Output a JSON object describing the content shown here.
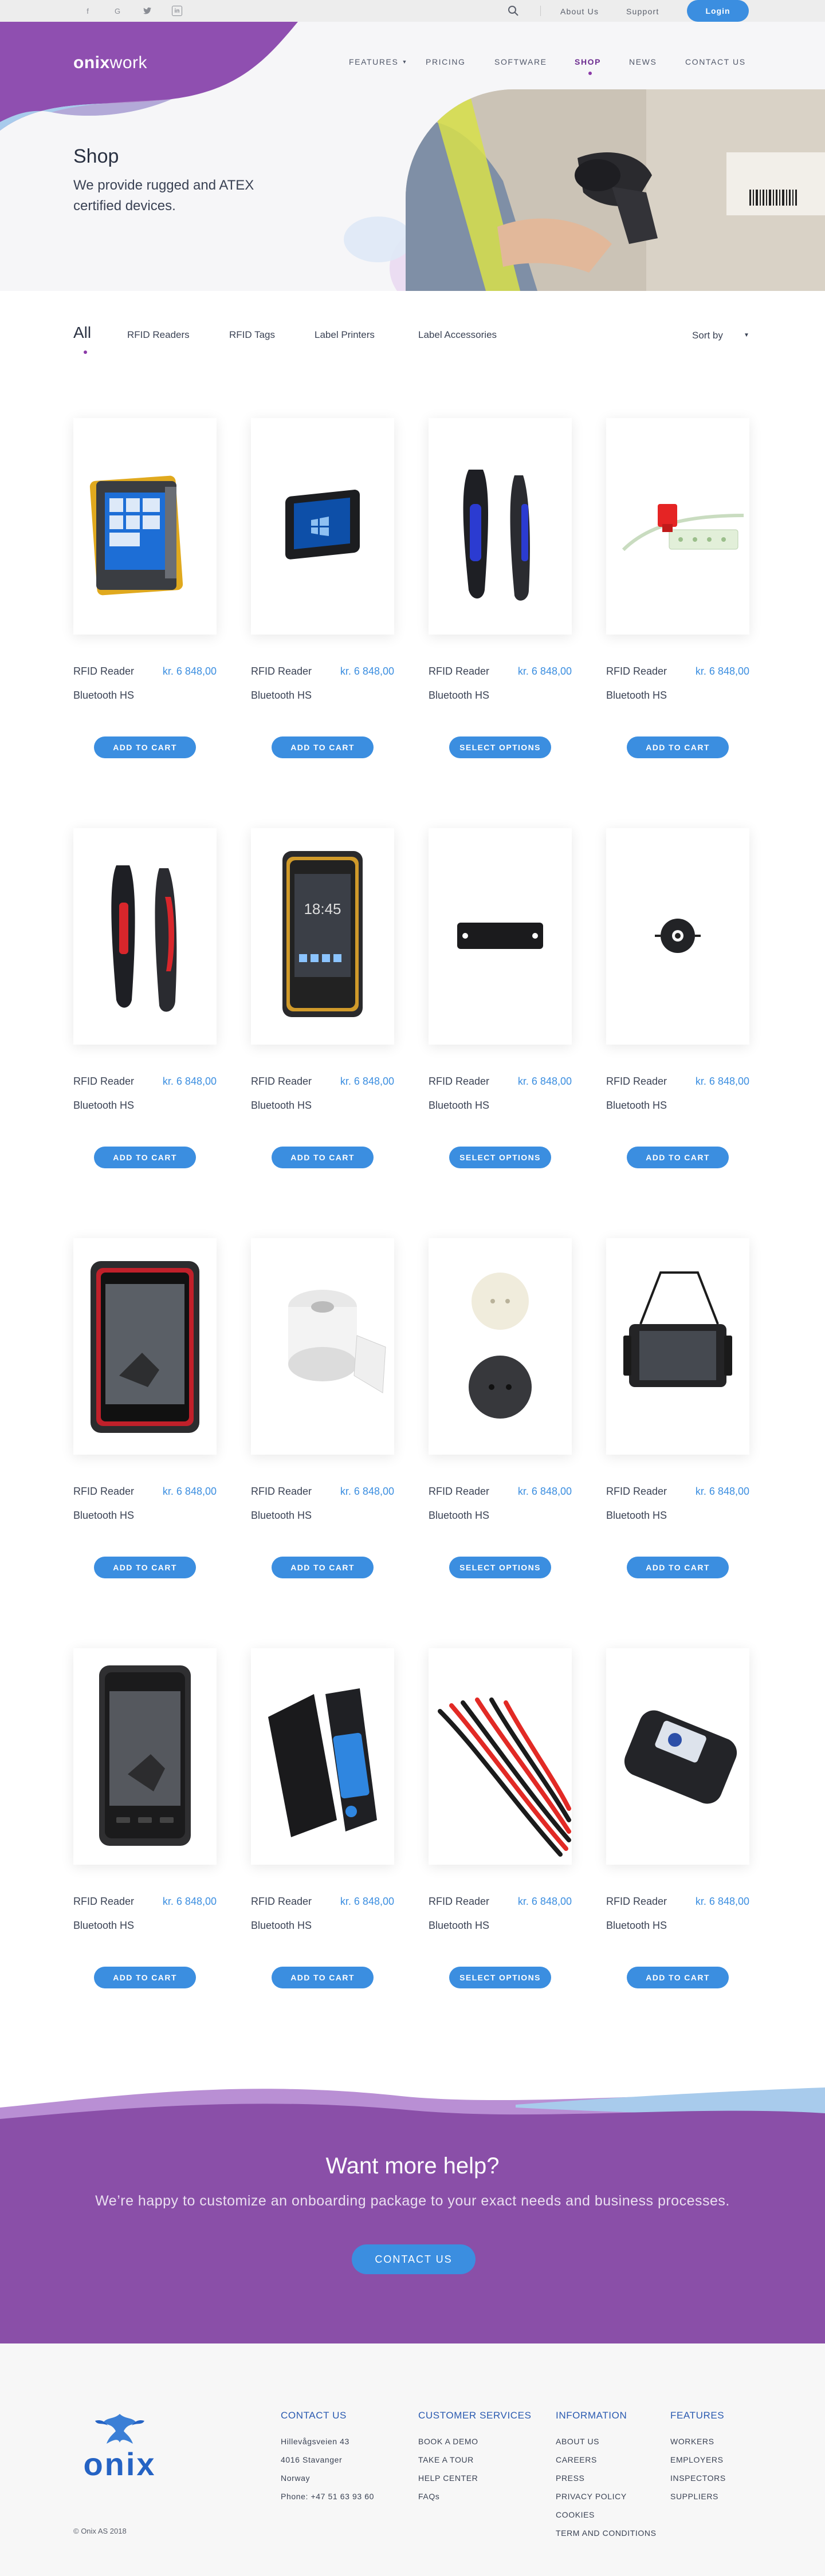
{
  "topbar": {
    "social": [
      {
        "icon": "facebook-icon",
        "glyph": "f"
      },
      {
        "icon": "google-icon",
        "glyph": "G"
      },
      {
        "icon": "twitter-icon",
        "glyph": "🐦"
      },
      {
        "icon": "linkedin-icon",
        "glyph": "in"
      }
    ],
    "about": "About Us",
    "support": "Support",
    "login": "Login"
  },
  "header": {
    "logo_main": "onix",
    "logo_suffix": "work",
    "nav": [
      "FEATURES",
      "PRICING",
      "SOFTWARE",
      "SHOP",
      "NEWS",
      "CONTACT US"
    ],
    "active": "SHOP"
  },
  "hero": {
    "title": "Shop",
    "subtitle": "We provide rugged and ATEX certified devices."
  },
  "filters": {
    "items": [
      "All",
      "RFID Readers",
      "RFID Tags",
      "Label Printers",
      "Label Accessories"
    ],
    "sort_label": "Sort by"
  },
  "products": [
    {
      "name": "RFID Reader",
      "price": "kr. 6 848,00",
      "sub": "Bluetooth HS",
      "button": "ADD TO CART",
      "image": "rugged-tablet-yellow"
    },
    {
      "name": "RFID Reader",
      "price": "kr. 6 848,00",
      "sub": "Bluetooth HS",
      "button": "ADD TO CART",
      "image": "black-tablet-windows"
    },
    {
      "name": "RFID Reader",
      "price": "kr. 6 848,00",
      "sub": "Bluetooth HS",
      "button": "SELECT OPTIONS",
      "image": "handheld-blue"
    },
    {
      "name": "RFID Reader",
      "price": "kr. 6 848,00",
      "sub": "Bluetooth HS",
      "button": "ADD TO CART",
      "image": "cable-tie-tag"
    },
    {
      "name": "RFID Reader",
      "price": "kr. 6 848,00",
      "sub": "Bluetooth HS",
      "button": "ADD TO CART",
      "image": "handheld-red"
    },
    {
      "name": "RFID Reader",
      "price": "kr. 6 848,00",
      "sub": "Bluetooth HS",
      "button": "ADD TO CART",
      "image": "rugged-phone"
    },
    {
      "name": "RFID Reader",
      "price": "kr. 6 848,00",
      "sub": "Bluetooth HS",
      "button": "SELECT OPTIONS",
      "image": "metal-tag"
    },
    {
      "name": "RFID Reader",
      "price": "kr. 6 848,00",
      "sub": "Bluetooth HS",
      "button": "ADD TO CART",
      "image": "round-tag-black"
    },
    {
      "name": "RFID Reader",
      "price": "kr. 6 848,00",
      "sub": "Bluetooth HS",
      "button": "ADD TO CART",
      "image": "rugged-tablet-red"
    },
    {
      "name": "RFID Reader",
      "price": "kr. 6 848,00",
      "sub": "Bluetooth HS",
      "button": "ADD TO CART",
      "image": "label-roll"
    },
    {
      "name": "RFID Reader",
      "price": "kr. 6 848,00",
      "sub": "Bluetooth HS",
      "button": "SELECT OPTIONS",
      "image": "round-tags"
    },
    {
      "name": "RFID Reader",
      "price": "kr. 6 848,00",
      "sub": "Bluetooth HS",
      "button": "ADD TO CART",
      "image": "tablet-strap"
    },
    {
      "name": "RFID Reader",
      "price": "kr. 6 848,00",
      "sub": "Bluetooth HS",
      "button": "ADD TO CART",
      "image": "rugged-phone-dark"
    },
    {
      "name": "RFID Reader",
      "price": "kr. 6 848,00",
      "sub": "Bluetooth HS",
      "button": "ADD TO CART",
      "image": "blue-reader"
    },
    {
      "name": "RFID Reader",
      "price": "kr. 6 848,00",
      "sub": "Bluetooth HS",
      "button": "SELECT OPTIONS",
      "image": "cable-ties"
    },
    {
      "name": "RFID Reader",
      "price": "kr. 6 848,00",
      "sub": "Bluetooth HS",
      "button": "ADD TO CART",
      "image": "card-reader"
    }
  ],
  "cta": {
    "title": "Want more help?",
    "subtitle": "We’re happy to customize an onboarding package to your exact needs and business processes.",
    "button": "CONTACT US"
  },
  "footer": {
    "logo_text": "onix",
    "copyright": "© Onix AS 2018",
    "columns": [
      {
        "title": "CONTACT US",
        "items": [
          "Hillevågsveien 43",
          "4016 Stavanger",
          "Norway",
          "Phone: +47 51 63 93 60"
        ]
      },
      {
        "title": "CUSTOMER SERVICES",
        "items": [
          "BOOK A DEMO",
          "TAKE A TOUR",
          "HELP CENTER",
          "FAQs"
        ]
      },
      {
        "title": "INFORMATION",
        "items": [
          "ABOUT US",
          "CAREERS",
          "PRESS",
          "PRIVACY POLICY",
          "COOKIES",
          "TERM AND CONDITIONS"
        ]
      },
      {
        "title": "FEATURES",
        "items": [
          "WORKERS",
          "EMPLOYERS",
          "INSPECTORS",
          "SUPPLIERS"
        ]
      }
    ]
  },
  "colors": {
    "accent": "#3b8ee0",
    "brand_purple": "#8a4fa8",
    "nav_active": "#6b2b8f"
  }
}
